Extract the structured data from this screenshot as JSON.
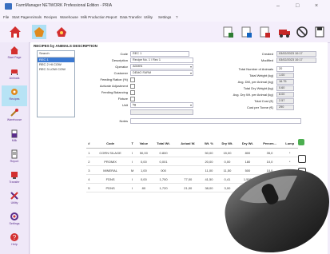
{
  "window": {
    "title": "FarmManager NETWORK Professional Edition - PRIA",
    "min": "–",
    "max": "□",
    "close": "×"
  },
  "menu": [
    "File",
    "Start Page",
    "Animals",
    "Recipes",
    "Warehouse",
    "Milk Production",
    "Report",
    "Data Transfer",
    "Utility",
    "Settings",
    "?"
  ],
  "sidebar": [
    {
      "label": "Start Page",
      "icon": "home-icon"
    },
    {
      "label": "Animals",
      "icon": "cow-icon"
    },
    {
      "label": "Recipes",
      "icon": "recipe-icon",
      "active": true
    },
    {
      "label": "Warehouse",
      "icon": "warehouse-icon"
    },
    {
      "label": "Milk",
      "icon": "milk-icon"
    },
    {
      "label": "Report",
      "icon": "report-icon"
    },
    {
      "label": "Transfer",
      "icon": "transfer-icon"
    },
    {
      "label": "Utility",
      "icon": "utility-icon"
    },
    {
      "label": "Settings",
      "icon": "settings-icon"
    },
    {
      "label": "Help",
      "icon": "help-icon"
    }
  ],
  "section_title": "RECIPES by ANIMALS DESCRIPTION",
  "recipe_list": {
    "search": "Search",
    "items": [
      "REC 1",
      "REC 2 HI COW",
      "REC 3 LOW COW"
    ]
  },
  "form": {
    "code_label": "Code",
    "code": "REC 1",
    "desc_label": "Description",
    "desc": "Recipe No. 1 / Rec 1",
    "operator_label": "Operator",
    "operator": "ADMIN",
    "customer_label": "Customer",
    "customer": "DEMO FARM",
    "feeding_label": "Feeding Ration (%)",
    "feeding": "",
    "activate_label": "Activate Adjustment",
    "balancing_label": "Feeding Balancing",
    "fixed_label": "Fixture",
    "unit_label": "Unit",
    "unit": "kg",
    "notes_label": "Notes",
    "created_label": "Created",
    "created": "03/02/2023 10:17",
    "modified_label": "Modified",
    "modified": "03/02/2023 10:17",
    "heads_label": "Total Number of Animals",
    "heads": "20",
    "weight_label": "Total Weight (kg)",
    "weight": "1.00",
    "dm_label": "Avg. DM, per Animal (kg)",
    "dm": "16.75",
    "total_dm_label": "Total Dry Weight (kg)",
    "total_dm": "0.60",
    "animal_label": "Avg. Dry Wt. per Animal (kg)",
    "animal": "8.00",
    "cost_label": "Total Cost (€)",
    "cost": "2.57",
    "cost_ton_label": "Cost per Tonne (€)",
    "cost_ton": "290"
  },
  "grid": {
    "headers": [
      "#",
      "Code",
      "T",
      "Value",
      "Total Wt.",
      "Actual W.",
      "Wt. %",
      "Dry Wt.",
      "Dry Wt.",
      "Percen...",
      "Lump"
    ],
    "rows": [
      [
        "1",
        "CORN SILAGE",
        "I",
        "50,00",
        "0.800",
        "",
        "50,00",
        "15,00",
        "800",
        "35,0",
        "*"
      ],
      [
        "2",
        "PROMIX",
        "I",
        "0,00",
        "0,001",
        "",
        "20,00",
        "0,00",
        "180",
        "10,0",
        "*"
      ],
      [
        "3",
        "MINERAL",
        "M",
        "1,00",
        "000",
        "",
        "11,00",
        "11,50",
        "500",
        "10,0",
        "*"
      ],
      [
        "4",
        "FDNS",
        "I",
        "0,00",
        "1,700",
        "77,00",
        "41,50",
        "0,41",
        "1,500",
        "",
        ""
      ],
      [
        "5",
        "PDNS",
        "I",
        "80",
        "1,720",
        "21,00",
        "38,00",
        "3,00",
        "1,810",
        "",
        ""
      ]
    ]
  }
}
